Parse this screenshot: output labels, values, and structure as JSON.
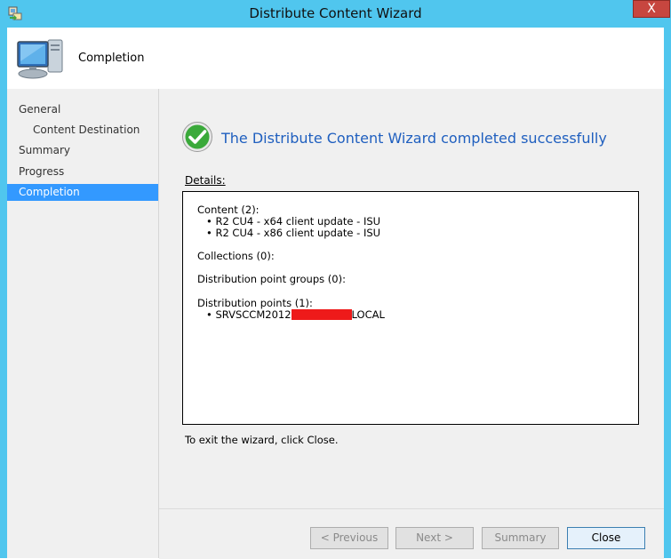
{
  "window": {
    "title": "Distribute Content Wizard",
    "close_glyph": "X"
  },
  "header": {
    "title": "Completion",
    "icon": "computer-icon"
  },
  "nav": {
    "items": [
      {
        "label": "General",
        "level": 0,
        "active": false
      },
      {
        "label": "Content Destination",
        "level": 1,
        "active": false
      },
      {
        "label": "Summary",
        "level": 0,
        "active": false
      },
      {
        "label": "Progress",
        "level": 0,
        "active": false
      },
      {
        "label": "Completion",
        "level": 0,
        "active": true
      }
    ]
  },
  "main": {
    "success_message": "The Distribute Content Wizard completed successfully",
    "details_label": "Details:",
    "details": {
      "content_heading": "Content (2):",
      "content_items": [
        "R2 CU4 - x64 client update - ISU",
        "R2 CU4 - x86 client update - ISU"
      ],
      "collections_heading": "Collections (0):",
      "dp_groups_heading": "Distribution point groups (0):",
      "dp_heading": "Distribution points (1):",
      "dp_item_prefix": "SRVSCCM2012",
      "dp_item_suffix": "LOCAL"
    },
    "exit_text": "To exit the wizard, click Close."
  },
  "buttons": {
    "previous": "< Previous",
    "next": "Next >",
    "summary": "Summary",
    "close": "Close"
  },
  "colors": {
    "title_bar": "#50c6ee",
    "close_button": "#c7463f",
    "selection": "#3399ff",
    "success_text": "#1f5fbf",
    "redaction": "#ee1a1a"
  }
}
